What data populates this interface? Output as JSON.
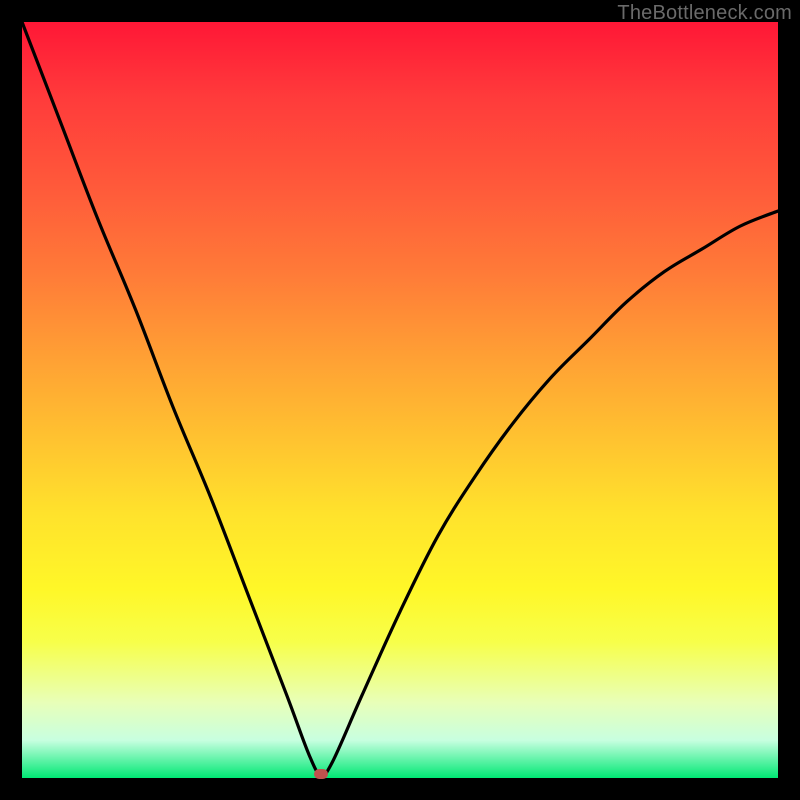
{
  "watermark": "TheBottleneck.com",
  "colors": {
    "frame": "#000000",
    "curve": "#000000",
    "marker": "#c0524e",
    "gradient_top": "#ff1736",
    "gradient_bottom": "#00e874"
  },
  "chart_data": {
    "type": "line",
    "title": "",
    "xlabel": "",
    "ylabel": "",
    "xlim": [
      0,
      100
    ],
    "ylim": [
      0,
      100
    ],
    "grid": false,
    "legend": false,
    "series": [
      {
        "name": "bottleneck-curve",
        "x": [
          0,
          5,
          10,
          15,
          20,
          25,
          30,
          35,
          38,
          39.5,
          41,
          45,
          50,
          55,
          60,
          65,
          70,
          75,
          80,
          85,
          90,
          95,
          100
        ],
        "y": [
          100,
          87,
          74,
          62,
          49,
          37,
          24,
          11,
          3,
          0.5,
          2,
          11,
          22,
          32,
          40,
          47,
          53,
          58,
          63,
          67,
          70,
          73,
          75
        ]
      }
    ],
    "marker": {
      "x": 39.5,
      "y": 0.5
    }
  }
}
